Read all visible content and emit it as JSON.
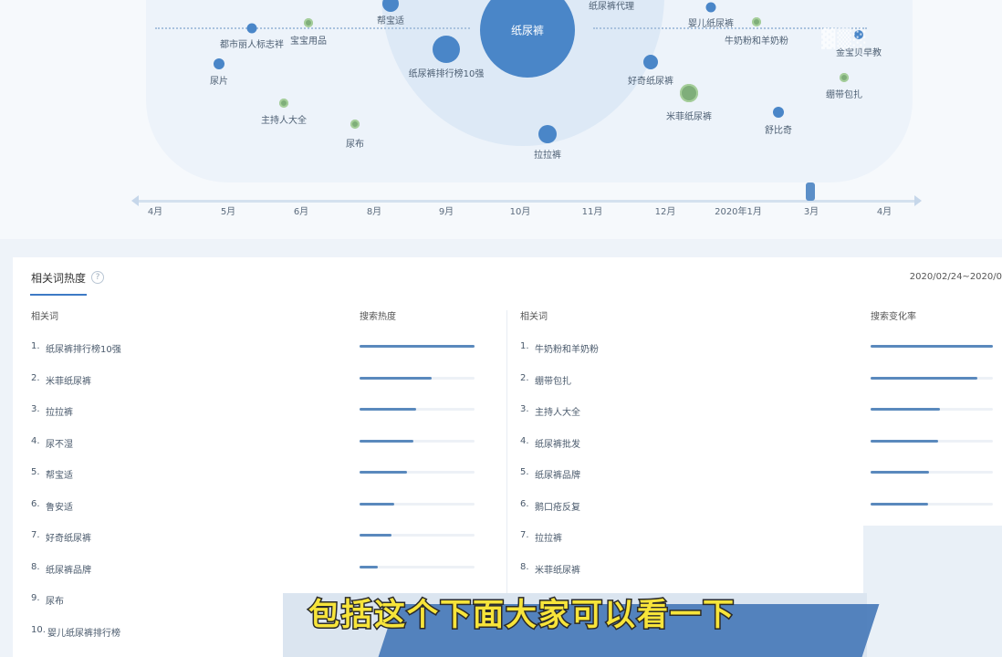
{
  "bubble_map": {
    "center_label": "纸尿裤",
    "bubbles": [
      {
        "label": "帮宝适"
      },
      {
        "label": "都市丽人标志袢"
      },
      {
        "label": "宝宝用品"
      },
      {
        "label": "尿片"
      },
      {
        "label": "纸尿裤排行榜10强"
      },
      {
        "label": "主持人大全"
      },
      {
        "label": "尿布"
      },
      {
        "label": "纸尿裤代理"
      },
      {
        "label": "婴儿纸尿裤"
      },
      {
        "label": "牛奶粉和羊奶粉"
      },
      {
        "label": "金宝贝早教"
      },
      {
        "label": "好奇纸尿裤"
      },
      {
        "label": "绷带包扎"
      },
      {
        "label": "米菲纸尿裤"
      },
      {
        "label": "舒比奇"
      },
      {
        "label": "拉拉裤"
      }
    ],
    "timeline_months": [
      "4月",
      "5月",
      "6月",
      "8月",
      "9月",
      "10月",
      "11月",
      "12月",
      "2020年1月",
      "3月",
      "4月"
    ]
  },
  "panel": {
    "title": "相关词热度",
    "help_icon": "question-icon",
    "date_range": "2020/02/24~2020/0",
    "left_col_head": "相关词",
    "left_metric_head": "搜索热度",
    "right_col_head": "相关词",
    "right_metric_head": "搜索变化率",
    "left_rows": [
      {
        "rank": "1.",
        "word": "纸尿裤排行榜10强",
        "level": 1.0
      },
      {
        "rank": "2.",
        "word": "米菲纸尿裤",
        "level": 0.63
      },
      {
        "rank": "3.",
        "word": "拉拉裤",
        "level": 0.49
      },
      {
        "rank": "4.",
        "word": "尿不湿",
        "level": 0.47
      },
      {
        "rank": "5.",
        "word": "帮宝适",
        "level": 0.41
      },
      {
        "rank": "6.",
        "word": "鲁安适",
        "level": 0.3
      },
      {
        "rank": "7.",
        "word": "好奇纸尿裤",
        "level": 0.28
      },
      {
        "rank": "8.",
        "word": "纸尿裤品牌",
        "level": 0.16
      },
      {
        "rank": "9.",
        "word": "尿布",
        "level": null
      },
      {
        "rank": "10.",
        "word": "婴儿纸尿裤排行榜",
        "level": null
      }
    ],
    "right_rows": [
      {
        "rank": "1.",
        "word": "牛奶粉和羊奶粉",
        "level": 1.0
      },
      {
        "rank": "2.",
        "word": "绷带包扎",
        "level": 0.87
      },
      {
        "rank": "3.",
        "word": "主持人大全",
        "level": 0.57
      },
      {
        "rank": "4.",
        "word": "纸尿裤批发",
        "level": 0.55
      },
      {
        "rank": "5.",
        "word": "纸尿裤品牌",
        "level": 0.48
      },
      {
        "rank": "6.",
        "word": "鹅口疮反复",
        "level": 0.47
      },
      {
        "rank": "7.",
        "word": "拉拉裤",
        "level": null
      },
      {
        "rank": "8.",
        "word": "米菲纸尿裤",
        "level": null
      }
    ]
  },
  "subtitle": "包括这个下面大家可以看一下",
  "colors": {
    "accent": "#3d7ac5",
    "bar": "#5a89bd",
    "subtitle": "#f7e43a"
  }
}
